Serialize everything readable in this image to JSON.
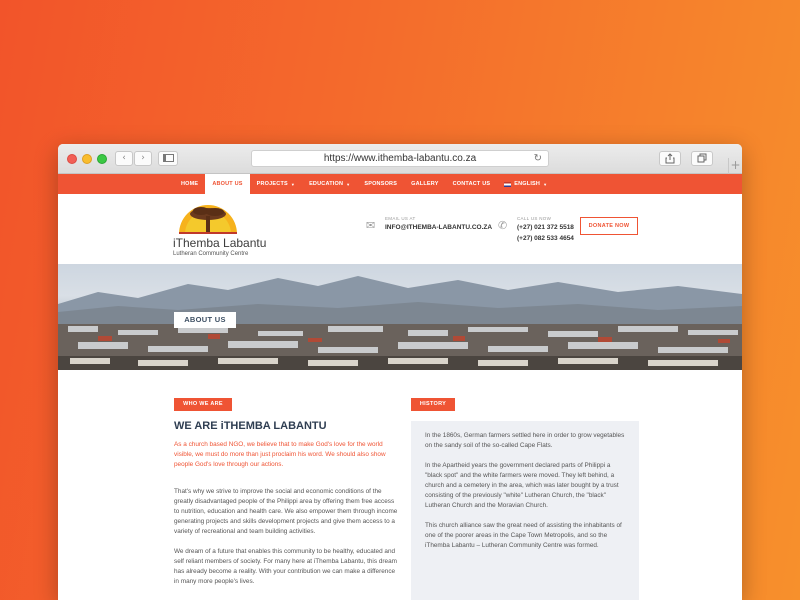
{
  "browser": {
    "url": "https://www.ithemba-labantu.co.za",
    "reload_icon": "reload-icon",
    "back_glyph": "‹",
    "forward_glyph": "›"
  },
  "menu": {
    "items": [
      {
        "label": "HOME"
      },
      {
        "label": "ABOUT US",
        "active": true
      },
      {
        "label": "PROJECTS",
        "caret": "▼"
      },
      {
        "label": "EDUCATION",
        "caret": "▼"
      },
      {
        "label": "SPONSORS"
      },
      {
        "label": "GALLERY"
      },
      {
        "label": "CONTACT US"
      },
      {
        "label": "ENGLISH",
        "caret": "▼"
      }
    ]
  },
  "header": {
    "logo_name": "iThemba Labantu",
    "logo_sub": "Lutheran Community Centre",
    "email_label": "EMAIL US AT",
    "email": "INFO@ITHEMBA-LABANTU.CO.ZA",
    "phone_label": "CALL US NOW",
    "phone_1": "(+27) 021 372 5518",
    "phone_2": "(+27) 082 533 4654",
    "donate_label": "DONATE NOW"
  },
  "hero": {
    "title": "ABOUT US"
  },
  "content": {
    "who_tag": "WHO WE ARE",
    "heading": "WE ARE iTHEMBA LABANTU",
    "intro": "As a church based NGO, we believe that to make God's love for the world visible, we must do more than just proclaim his word. We should also show people God's love through our actions.",
    "para_1": "That's why we strive to improve the social and economic conditions of the greatly disadvantaged people of the Philippi area by offering them free access to nutrition, education and health care. We also empower them through income generating projects and skills development projects and give them access to a variety of recreational and team building activities.",
    "para_2": "We dream of a future that enables this community to be healthy, educated and self reliant members of society. For many here at iThemba Labantu, this dream has already become a reality. With your contribution we can make a difference in many more people's lives.",
    "history_tag": "HISTORY",
    "history": [
      "In the 1860s, German farmers settled here in order to grow vegetables on the sandy soil of the so-called Cape Flats.",
      "In the Apartheid years the government declared parts of Philippi a \"black spot\" and the white farmers were moved. They left behind, a church and a cemetery in the area, which was later bought by a trust consisting of the previously \"white\" Lutheran Church, the \"black\" Lutheran Church and the Moravian Church.",
      "This church alliance saw the great need of assisting the inhabitants of one of the poorer areas in the Cape Town Metropolis, and so the iThemba Labantu – Lutheran Community Centre was formed."
    ]
  },
  "colors": {
    "accent": "#ef5434",
    "heading": "#2f3e52",
    "history_bg": "#eef0f4"
  }
}
